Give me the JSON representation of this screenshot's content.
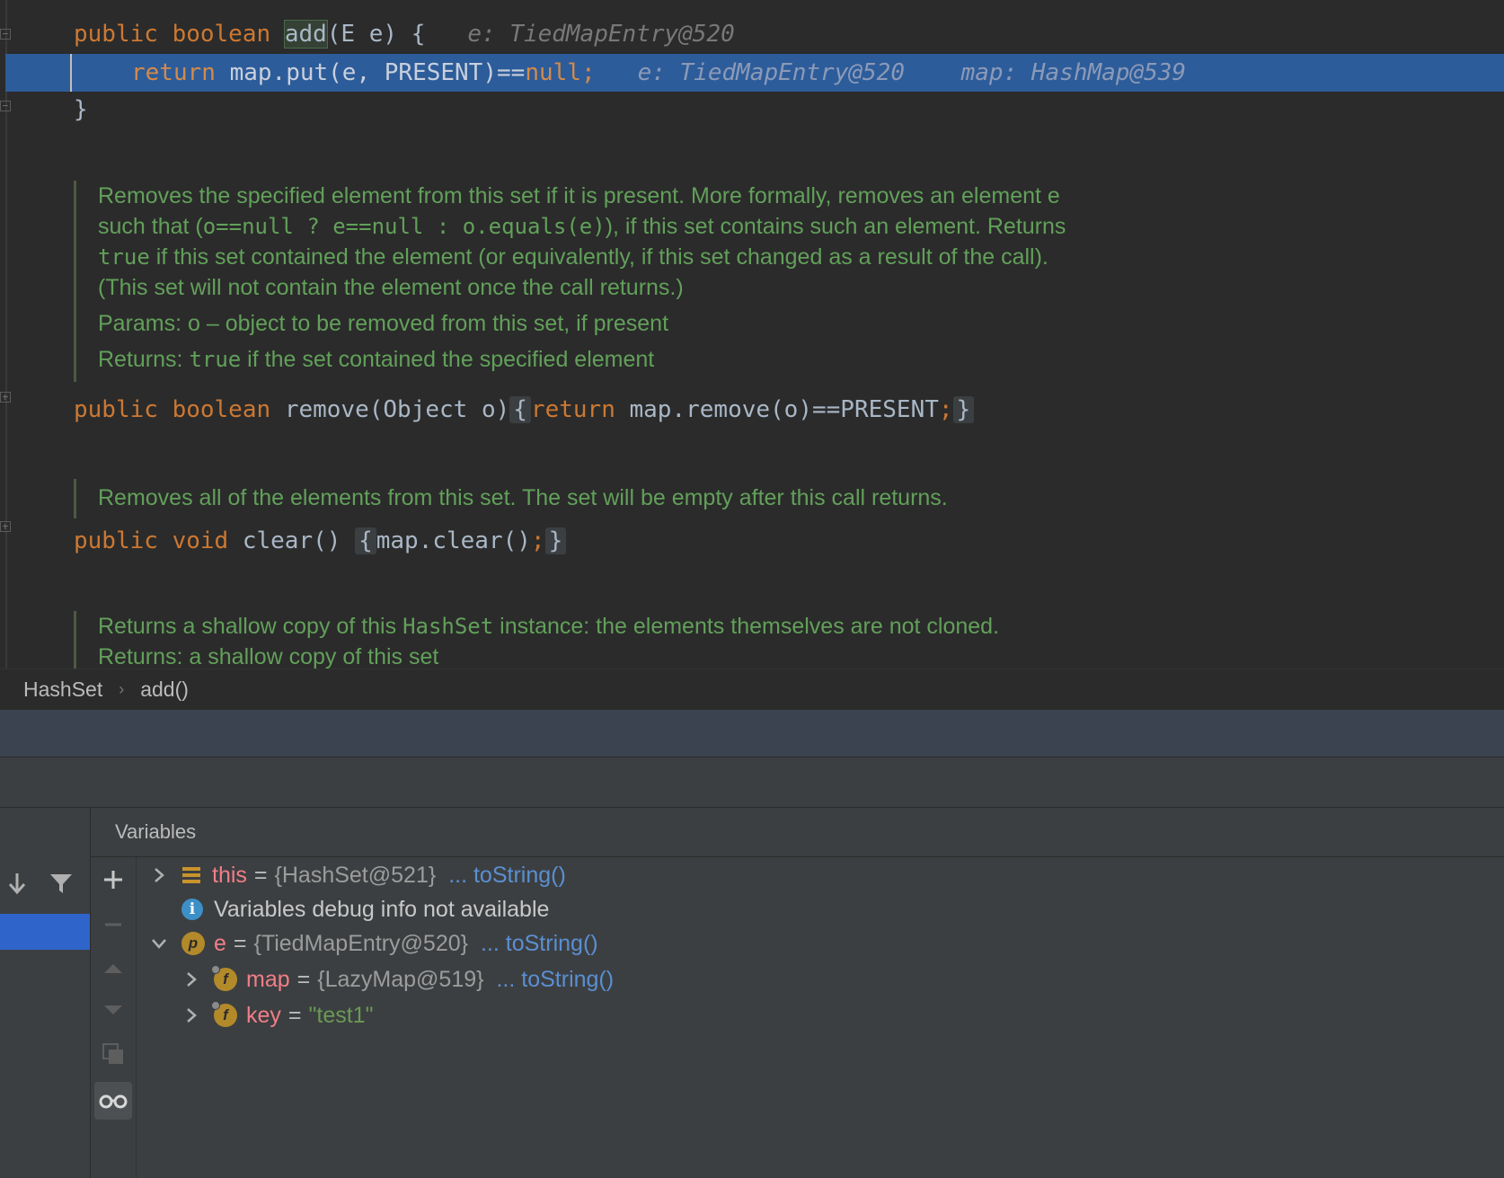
{
  "editor": {
    "line_add_signature": {
      "modifiers": "public boolean",
      "method": "add",
      "params": "(E e) {",
      "inline_hint": "e: TiedMapEntry@520"
    },
    "line_return_put": {
      "keyword": "return",
      "code": "map.put(e, PRESENT)",
      "op": "==",
      "null_kw": "null",
      "semicolon": ";",
      "hint_e": "e: TiedMapEntry@520",
      "hint_map": "map: HashMap@539"
    },
    "close_brace": "}",
    "doc_remove": {
      "line1": "Removes the specified element from this set if it is present. More formally, removes an element e",
      "line2_pre": "such that (",
      "line2_code": "o==null ? e==null : o.equals(e)",
      "line2_post": "), if this set contains such an element. Returns",
      "line3_code": "true",
      "line3_post": " if this set contained the element (or equivalently, if this set changed as a result of the call).",
      "line4": "(This set will not contain the element once the call returns.)",
      "params": "Params:  o – object to be removed from this set, if present",
      "returns_pre": "Returns: ",
      "returns_code": "true",
      "returns_post": " if the set contained the specified element"
    },
    "line_remove": {
      "modifiers": "public boolean",
      "signature": "remove(Object o)",
      "brace_open": "{",
      "keyword": "return",
      "body": "map.remove(o)==PRESENT",
      "semicolon": ";",
      "brace_close": "}"
    },
    "doc_clear": {
      "line1": "Removes all of the elements from this set. The set will be empty after this call returns."
    },
    "line_clear": {
      "modifiers": "public void",
      "signature": "clear()",
      "brace_open": "{",
      "body": "map.clear()",
      "semicolon": ";",
      "brace_close": "}"
    },
    "doc_clone": {
      "line1_pre": "Returns a shallow copy of this ",
      "line1_code": "HashSet",
      "line1_post": " instance: the elements themselves are not cloned.",
      "line2": "Returns: a shallow copy of this set"
    }
  },
  "breadcrumb": {
    "items": [
      "HashSet",
      "add()"
    ]
  },
  "debugger": {
    "variables_title": "Variables",
    "tree": [
      {
        "name": "this",
        "value": "{HashSet@521}",
        "tostring": "... toString()",
        "icon": "list-icon"
      },
      {
        "message": "Variables debug info not available",
        "icon": "info-icon"
      },
      {
        "name": "e",
        "value": "{TiedMapEntry@520}",
        "tostring": "... toString()",
        "icon": "parameter-icon",
        "badge": "p"
      },
      {
        "name": "map",
        "value": "{LazyMap@519}",
        "tostring": "... toString()",
        "icon": "field-icon",
        "badge": "f"
      },
      {
        "name": "key",
        "value": "\"test1\"",
        "icon": "field-icon",
        "badge": "f"
      }
    ]
  },
  "colors": {
    "editor_bg": "#2b2b2b",
    "execution_line": "#2d5c9a",
    "keyword": "#cc7832",
    "doc_comment": "#62a05a",
    "var_name": "#f17e88",
    "tostring_link": "#5b8fd2",
    "selected_frame": "#2f65ca"
  }
}
